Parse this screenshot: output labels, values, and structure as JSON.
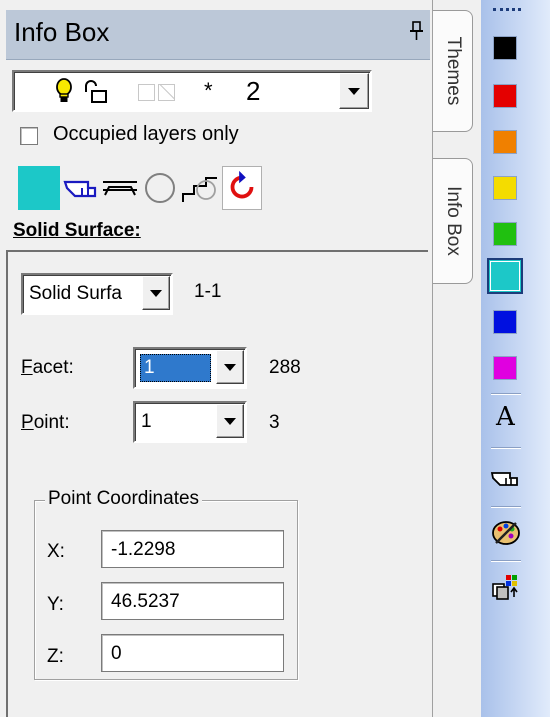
{
  "panel": {
    "title": "Info Box",
    "layer": {
      "star": "*",
      "number": "2"
    },
    "occupied_only_label": "Occupied layers only",
    "occupied_only_checked": false,
    "colors": {
      "title_bar": "#bcc8d8",
      "current_color": "#1cc8c8"
    },
    "section_title": "Solid Surface:"
  },
  "element": {
    "type_value": "Solid Surfa",
    "id_text": "1-1",
    "facet": {
      "label_key": "F",
      "label_rest": "acet:",
      "value": "1",
      "count": "288"
    },
    "point": {
      "label_key": "P",
      "label_rest": "oint:",
      "value": "1",
      "count": "3"
    }
  },
  "coordinates": {
    "group_label": "Point Coordinates",
    "x": {
      "label": "X:",
      "value": "-1.2298"
    },
    "y": {
      "label": "Y:",
      "value": "46.5237"
    },
    "z": {
      "label": "Z:",
      "value": "0"
    }
  },
  "tabs": [
    {
      "label": "Themes"
    },
    {
      "label": "Info Box"
    }
  ],
  "palette": {
    "swatches": [
      {
        "name": "black",
        "color": "#000000"
      },
      {
        "name": "red",
        "color": "#e40000"
      },
      {
        "name": "orange",
        "color": "#f08000"
      },
      {
        "name": "yellow",
        "color": "#f4dc00"
      },
      {
        "name": "green",
        "color": "#20c010"
      },
      {
        "name": "cyan",
        "color": "#1cc8c8",
        "selected": true
      },
      {
        "name": "blue",
        "color": "#0010e0"
      },
      {
        "name": "magenta",
        "color": "#e000e0"
      }
    ],
    "text_tool_glyph": "A",
    "tools": [
      "text-style-icon",
      "pointer-hand-icon",
      "paint-palette-icon",
      "layer-swap-icon"
    ]
  }
}
